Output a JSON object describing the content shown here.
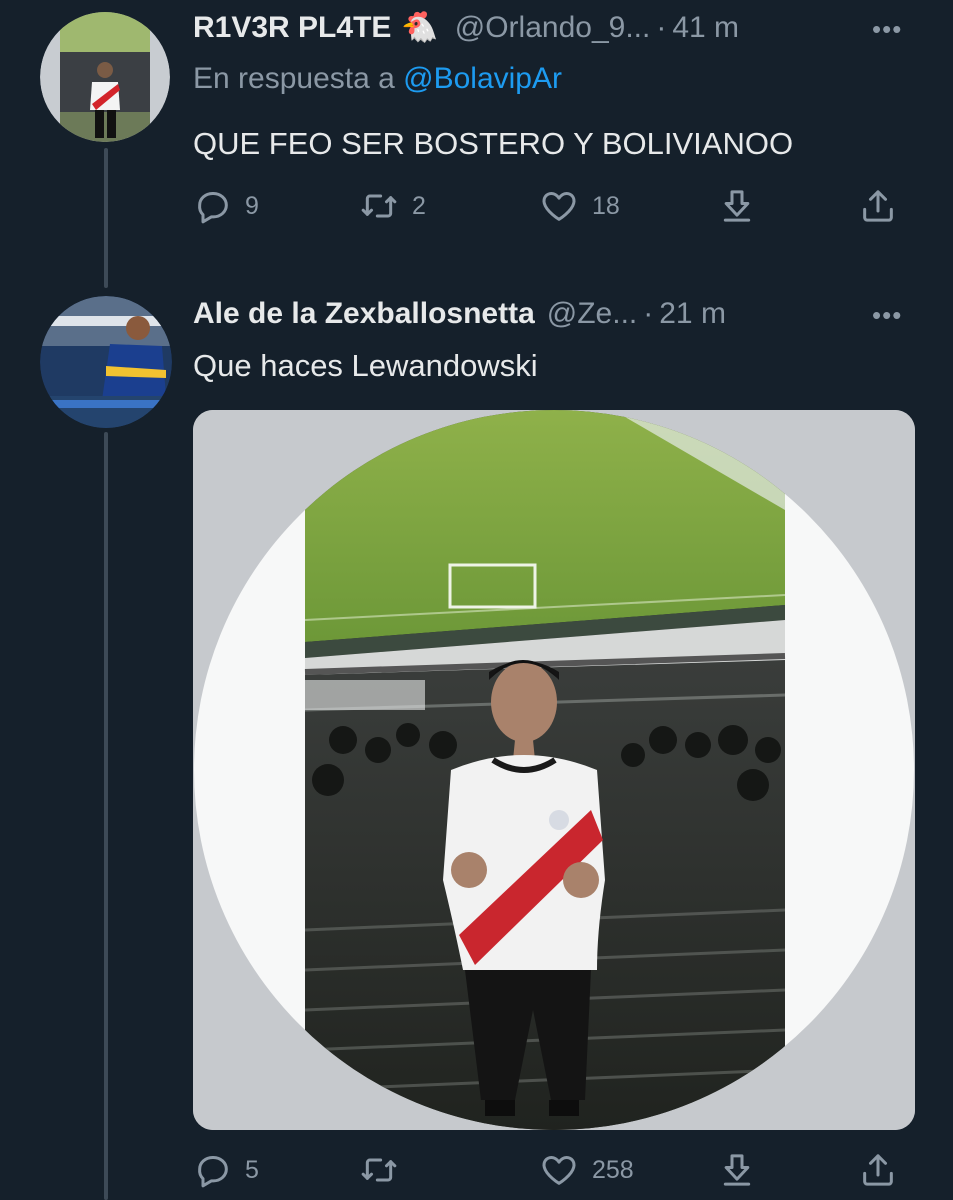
{
  "tweets": [
    {
      "display_name": "R1V3R PL4TE",
      "emoji": "🐔",
      "handle": "@Orlando_9...",
      "separator": "·",
      "time": "41 m",
      "reply_prefix": "En respuesta a",
      "reply_handle": "@BolavipAr",
      "text": "QUE FEO SER BOSTERO Y BOLIVIANOO",
      "actions": {
        "replies": "9",
        "retweets": "2",
        "likes": "18"
      }
    },
    {
      "display_name": "Ale de la Zexballosnetta",
      "handle": "@Ze...",
      "separator": "·",
      "time": "21 m",
      "text": "Que haces Lewandowski",
      "actions": {
        "replies": "5",
        "retweets": "",
        "likes": "258"
      }
    }
  ],
  "icons": {
    "more": "more-horizontal-icon",
    "reply": "comment-bubble-icon",
    "retweet": "retweet-icon",
    "like": "heart-icon",
    "download": "download-icon",
    "share": "share-icon"
  },
  "colors": {
    "background": "#15202b",
    "text": "#e7e9ea",
    "muted": "#8b98a5",
    "link": "#1d9bf0"
  }
}
